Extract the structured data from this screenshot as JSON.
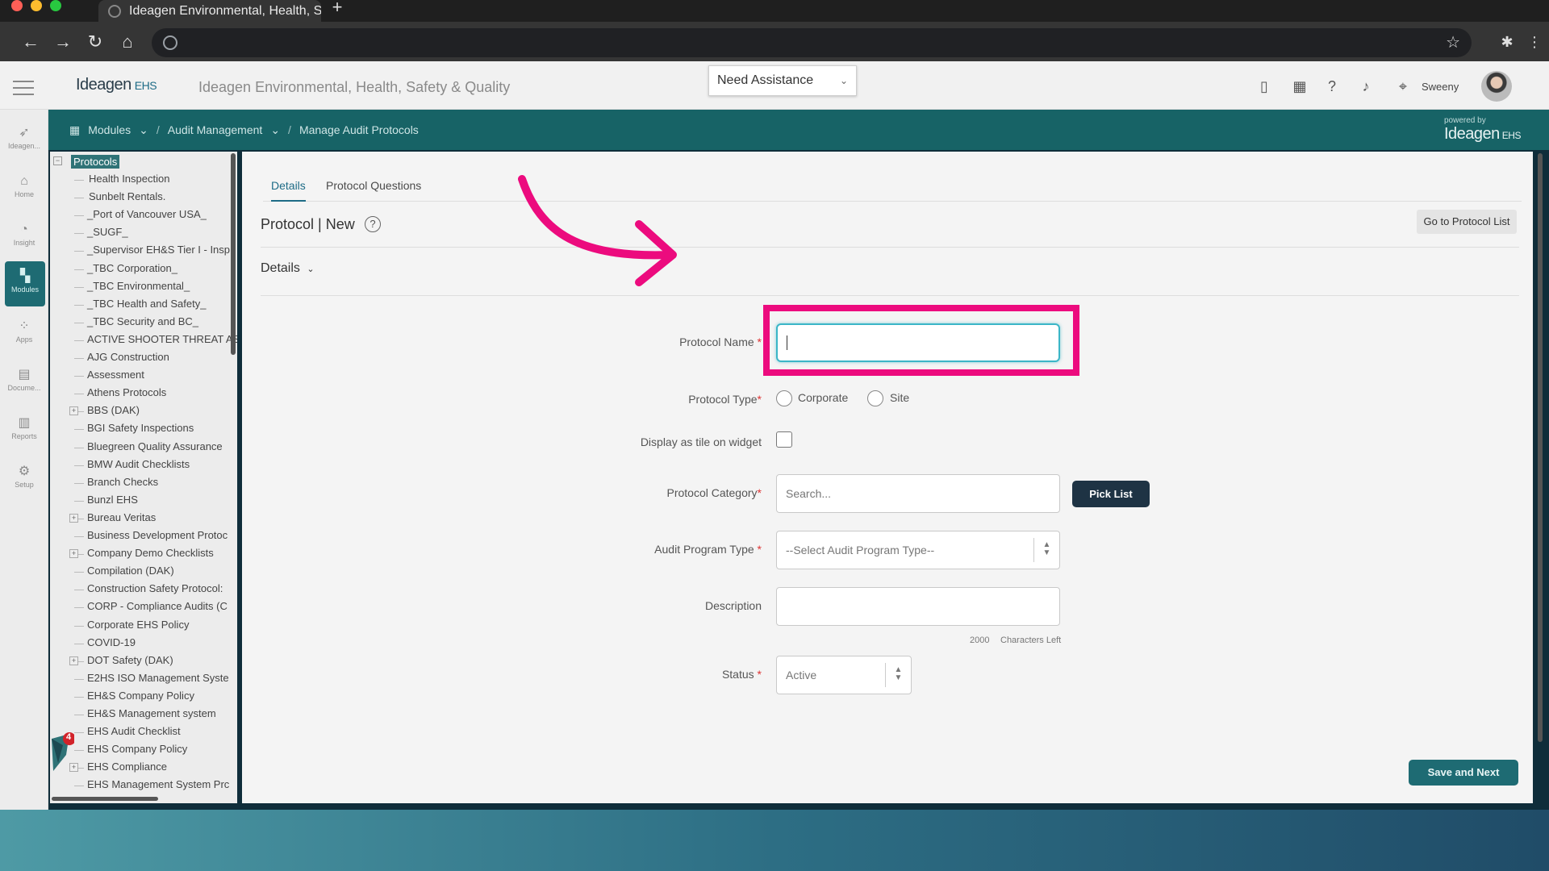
{
  "browser": {
    "tab_title": "Ideagen Environmental, Health, S:",
    "new_tab_label": "+"
  },
  "header": {
    "logo_text": "Ideagen",
    "logo_suffix": "EHS",
    "app_title": "Ideagen Environmental, Health, Safety & Quality",
    "assist_label": "Need Assistance",
    "user_name": "Sweeny"
  },
  "rail": {
    "items": [
      {
        "label": "Ideagen..."
      },
      {
        "label": "Home"
      },
      {
        "label": "Insight"
      },
      {
        "label": "Modules"
      },
      {
        "label": "Apps"
      },
      {
        "label": "Docume..."
      },
      {
        "label": "Reports"
      },
      {
        "label": "Setup"
      }
    ]
  },
  "breadcrumb": {
    "items": [
      "Modules",
      "Audit Management",
      "Manage Audit Protocols"
    ],
    "separator": "/",
    "powered_by": "powered by",
    "powered_logo": "Ideagen",
    "powered_suffix": "EHS"
  },
  "tree": {
    "root": "Protocols",
    "root_toggle": "−",
    "expander_symbol": "+",
    "badge_count": "4",
    "items": [
      "Health Inspection",
      "Sunbelt Rentals.",
      "_Port of Vancouver USA_",
      "_SUGF_",
      "_Supervisor EH&S Tier I - Insp",
      "_TBC Corporation_",
      "_TBC Environmental_",
      "_TBC Health and Safety_",
      "_TBC Security and BC_",
      "ACTIVE SHOOTER THREAT AS",
      "AJG Construction",
      "Assessment",
      "Athens Protocols",
      "BBS (DAK)",
      "BGI Safety Inspections",
      "Bluegreen Quality Assurance",
      "BMW Audit Checklists",
      "Branch Checks",
      "Bunzl EHS",
      "Bureau Veritas",
      "Business Development Protoc",
      "Company Demo Checklists",
      "Compilation (DAK)",
      "Construction Safety Protocol:",
      "CORP - Compliance Audits (C",
      "Corporate EHS Policy",
      "COVID-19",
      "DOT Safety (DAK)",
      "E2HS ISO Management Syste",
      "EH&S Company Policy",
      "EH&S Management system",
      "EHS Audit Checklist",
      "EHS Company Policy",
      "EHS Compliance",
      "EHS Management System Prc"
    ]
  },
  "main": {
    "tabs": [
      "Details",
      "Protocol Questions"
    ],
    "title": "Protocol | New",
    "help_symbol": "?",
    "goto_button": "Go to Protocol List",
    "section_header": "Details",
    "fields": {
      "protocol_name_label": "Protocol Name",
      "protocol_name_value": "",
      "protocol_type_label": "Protocol Type",
      "type_option_corporate": "Corporate",
      "type_option_site": "Site",
      "tile_label": "Display as tile on widget",
      "category_label": "Protocol Category",
      "category_placeholder": "Search...",
      "pick_list": "Pick List",
      "audit_type_label": "Audit Program Type",
      "audit_type_value": "--Select Audit Program Type--",
      "description_label": "Description",
      "description_value": "",
      "char_count": "2000",
      "char_suffix": "Characters Left",
      "status_label": "Status",
      "status_value": "Active",
      "required_mark": "*"
    },
    "save_button": "Save and Next"
  },
  "colors": {
    "teal": "#176366",
    "highlight": "#ec0b7e",
    "focus": "#3bb6c7"
  }
}
